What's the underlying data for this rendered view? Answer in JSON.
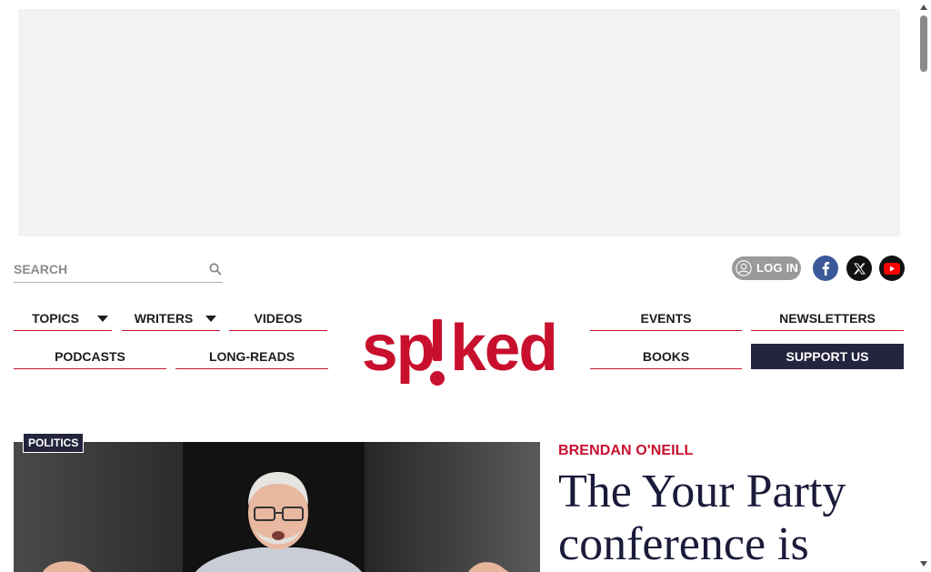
{
  "search": {
    "placeholder": "SEARCH"
  },
  "header": {
    "login_label": "LOG IN",
    "social": [
      "facebook-icon",
      "x-twitter-icon",
      "youtube-icon"
    ]
  },
  "nav": {
    "topics": "TOPICS",
    "writers": "WRITERS",
    "videos": "VIDEOS",
    "podcasts": "PODCASTS",
    "long_reads": "LONG-READS",
    "events": "EVENTS",
    "newsletters": "NEWSLETTERS",
    "books": "BOOKS",
    "support": "SUPPORT US"
  },
  "logo": {
    "text": "spiked"
  },
  "article": {
    "category": "POLITICS",
    "author": "BRENDAN O'NEILL",
    "headline": "The Your Party conference is"
  },
  "colors": {
    "brand_red": "#c8102e",
    "navy": "#24243e",
    "facebook": "#3b5998"
  }
}
